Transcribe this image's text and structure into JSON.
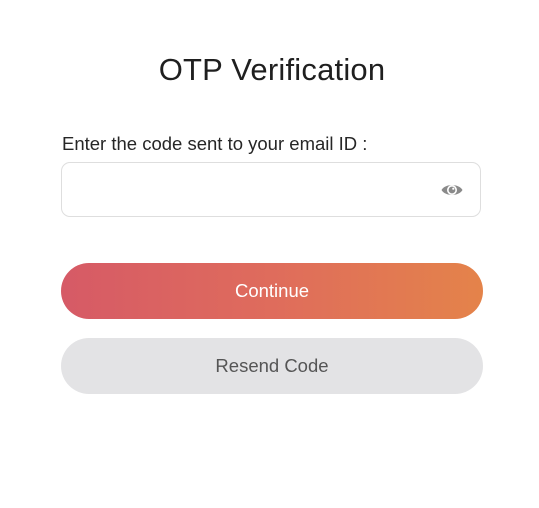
{
  "header": {
    "title": "OTP Verification"
  },
  "form": {
    "code_label": "Enter the code sent to your email ID :",
    "code_value": "",
    "eye_icon": "eye-icon"
  },
  "actions": {
    "continue_label": "Continue",
    "resend_label": "Resend Code"
  },
  "colors": {
    "continue_gradient_start": "#d65a66",
    "continue_gradient_end": "#e4834a",
    "resend_background": "#e3e3e5",
    "resend_text": "#555555"
  }
}
